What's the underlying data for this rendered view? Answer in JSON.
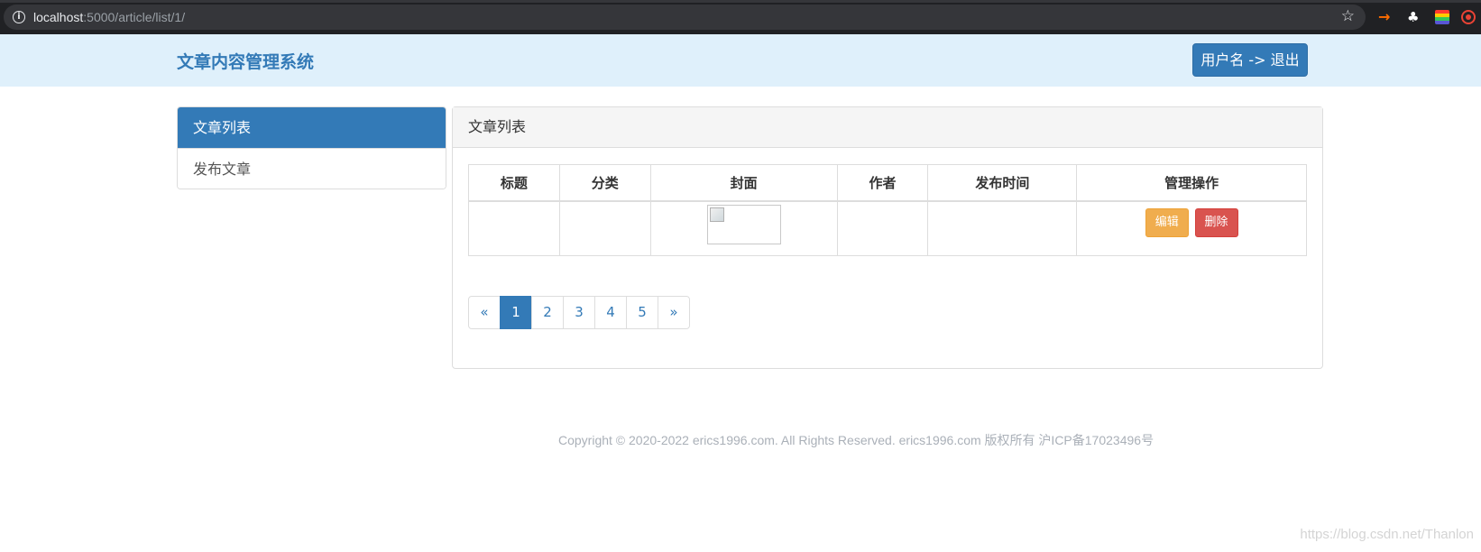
{
  "browser": {
    "url_host": "localhost",
    "url_path": ":5000/article/list/1/"
  },
  "header": {
    "brand": "文章内容管理系统",
    "user_button": "用户名 -> 退出"
  },
  "sidebar": {
    "items": [
      {
        "label": "文章列表",
        "active": true
      },
      {
        "label": "发布文章",
        "active": false
      }
    ]
  },
  "panel": {
    "title": "文章列表",
    "table": {
      "columns": [
        "标题",
        "分类",
        "封面",
        "作者",
        "发布时间",
        "管理操作"
      ],
      "rows": [
        {
          "title": "",
          "category": "",
          "author": "",
          "publish_time": "",
          "edit_label": "编辑",
          "delete_label": "删除"
        }
      ]
    },
    "pagination": {
      "prev": "«",
      "pages": [
        "1",
        "2",
        "3",
        "4",
        "5"
      ],
      "current": "1",
      "next": "»"
    }
  },
  "footer": {
    "copyright": "Copyright © 2020-2022  erics1996.com. All Rights Reserved. erics1996.com 版权所有 沪ICP备17023496号"
  },
  "watermark": "https://blog.csdn.net/Thanlon",
  "colors": {
    "primary": "#337ab7",
    "header_bg": "#dff0fb",
    "warning": "#f0ad4e",
    "danger": "#d9534f"
  }
}
